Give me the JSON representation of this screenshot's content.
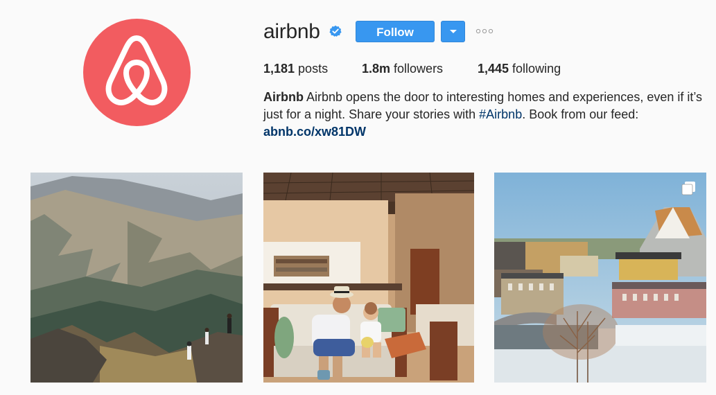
{
  "profile": {
    "username": "airbnb",
    "verified_icon": "verified-badge-icon",
    "follow_label": "Follow",
    "dropdown_icon": "chevron-down-icon",
    "more_icon": "more-options-icon"
  },
  "stats": {
    "posts_count": "1,181",
    "posts_label": " posts",
    "followers_count": "1.8m",
    "followers_label": " followers",
    "following_count": "1,445",
    "following_label": " following"
  },
  "bio": {
    "name": "Airbnb",
    "text_1": " Airbnb opens the door to interesting homes and experiences, even if it’s just for a night. Share your stories with ",
    "hashtag": "#Airbnb",
    "text_2": ". Book from our feed: ",
    "link": "abnb.co/xw81DW"
  },
  "colors": {
    "brand": "#f25c60",
    "button": "#3897f0",
    "link": "#003569"
  },
  "posts": [
    {
      "name": "mountain-hikers-post"
    },
    {
      "name": "father-son-living-room-post"
    },
    {
      "name": "riverside-town-post",
      "badge_icon": "multiple-photos-icon"
    }
  ]
}
